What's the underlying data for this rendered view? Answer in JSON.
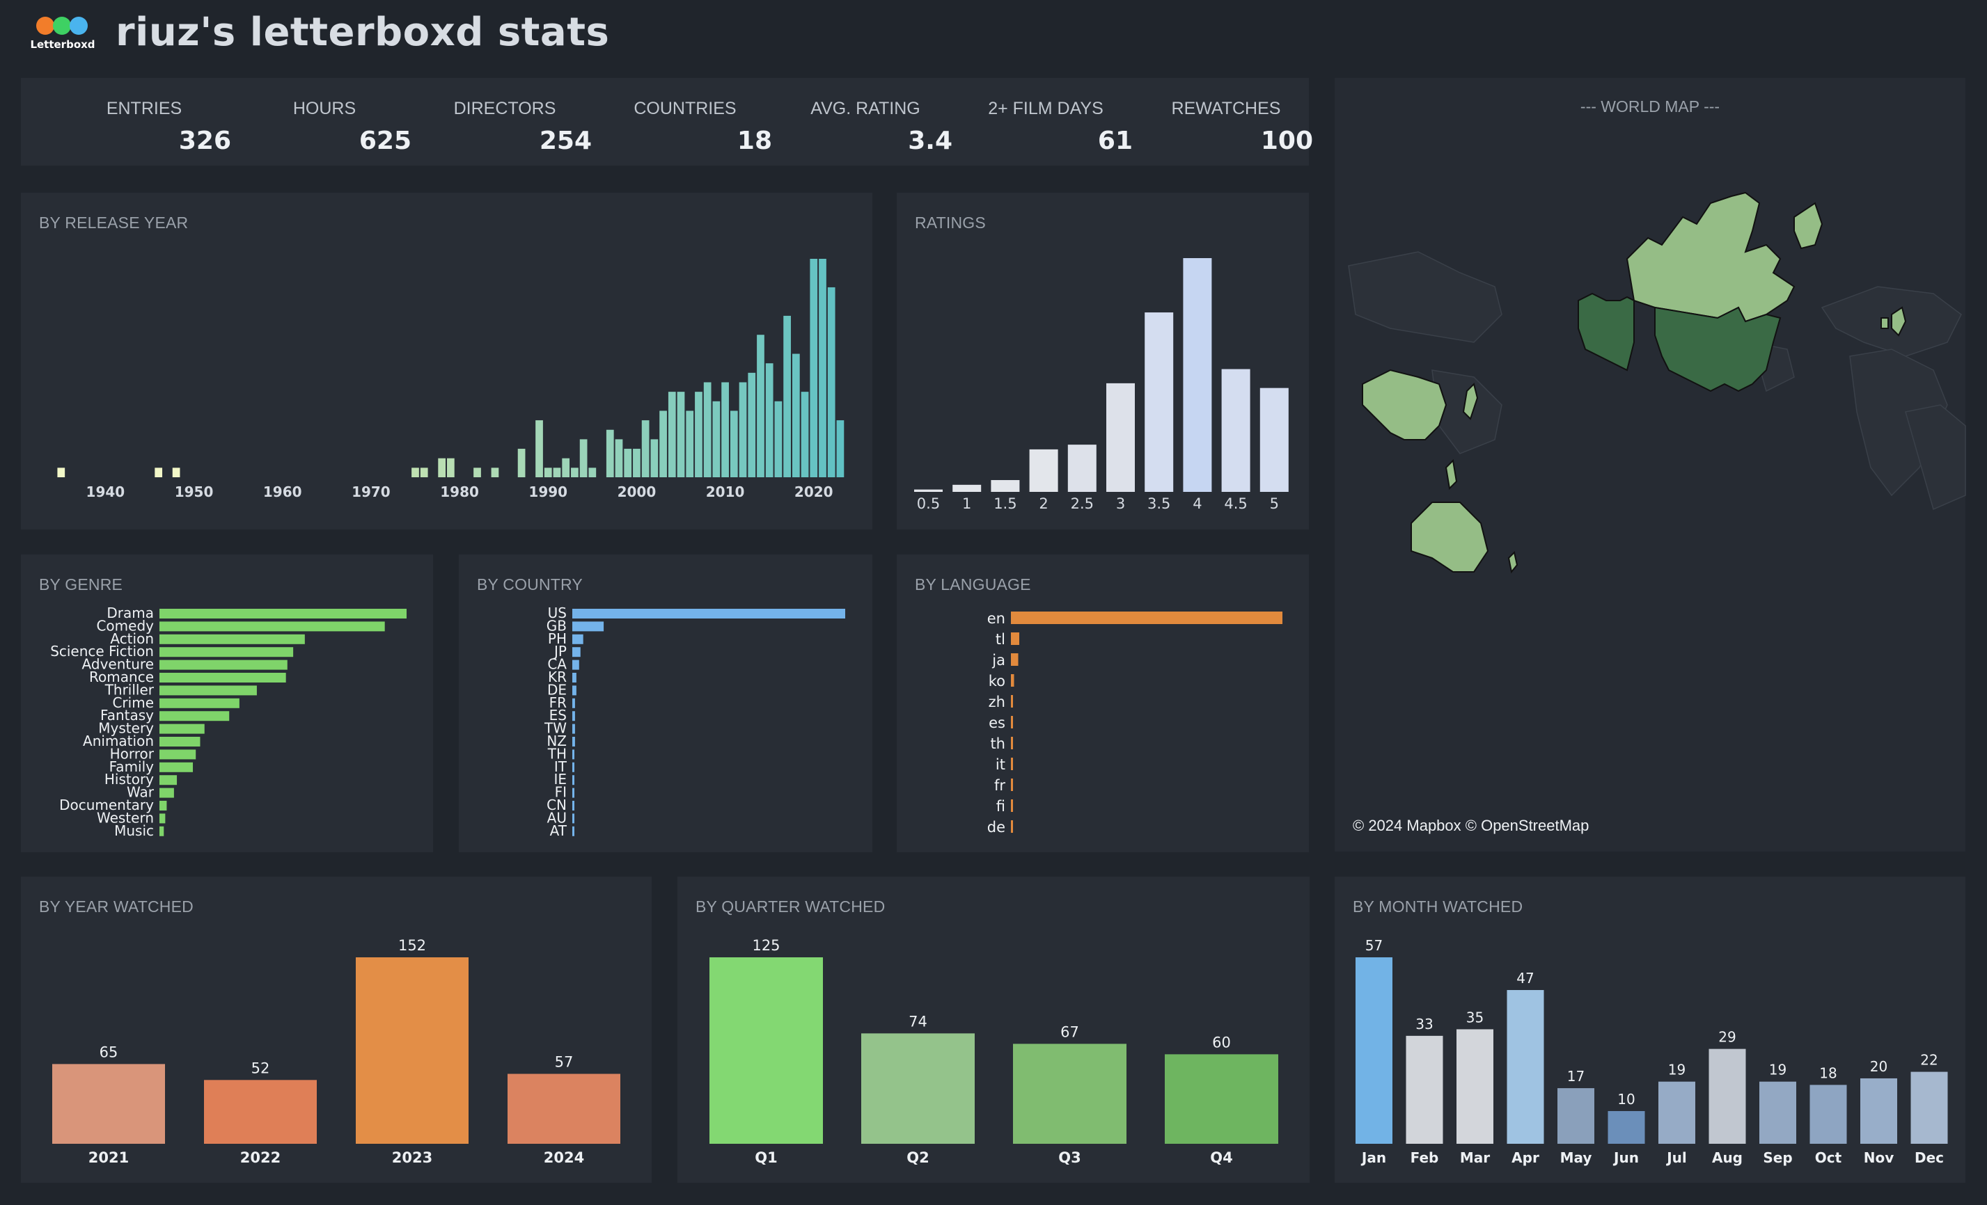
{
  "header": {
    "title": "riuz's letterboxd stats",
    "logo_text": "Letterboxd",
    "logo_colors": [
      "#ff8000",
      "#00e054",
      "#40bcf4"
    ]
  },
  "stats": [
    {
      "label": "ENTRIES",
      "value": "326"
    },
    {
      "label": "HOURS",
      "value": "625"
    },
    {
      "label": "DIRECTORS",
      "value": "254"
    },
    {
      "label": "COUNTRIES",
      "value": "18"
    },
    {
      "label": "AVG. RATING",
      "value": "3.4"
    },
    {
      "label": "2+ FILM DAYS",
      "value": "61"
    },
    {
      "label": "REWATCHES",
      "value": "100"
    }
  ],
  "panels": {
    "release_year": "BY RELEASE YEAR",
    "ratings": "RATINGS",
    "genre": "BY GENRE",
    "country": "BY COUNTRY",
    "language": "BY LANGUAGE",
    "year_watched": "BY YEAR WATCHED",
    "quarter_watched": "BY QUARTER WATCHED",
    "month_watched": "BY MONTH WATCHED",
    "world_map": "--- WORLD MAP ---",
    "map_attribution": "© 2024 Mapbox © OpenStreetMap"
  },
  "chart_data": [
    {
      "id": "release_year",
      "type": "bar",
      "title": "BY RELEASE YEAR",
      "x_ticks": [
        "1940",
        "1950",
        "1960",
        "1970",
        "1980",
        "1990",
        "2000",
        "2010",
        "2020"
      ],
      "x": [
        1935,
        1946,
        1948,
        1975,
        1976,
        1978,
        1979,
        1982,
        1984,
        1987,
        1989,
        1990,
        1991,
        1992,
        1993,
        1994,
        1995,
        1997,
        1998,
        1999,
        2000,
        2001,
        2002,
        2003,
        2004,
        2005,
        2006,
        2007,
        2008,
        2009,
        2010,
        2011,
        2012,
        2013,
        2014,
        2015,
        2016,
        2017,
        2018,
        2019,
        2020,
        2021,
        2022,
        2023
      ],
      "values": [
        1,
        1,
        1,
        1,
        1,
        2,
        2,
        1,
        1,
        3,
        6,
        1,
        1,
        2,
        1,
        4,
        1,
        5,
        4,
        3,
        3,
        6,
        4,
        7,
        9,
        9,
        7,
        9,
        10,
        8,
        10,
        7,
        10,
        11,
        15,
        12,
        8,
        17,
        13,
        9,
        23,
        23,
        20,
        6
      ]
    },
    {
      "id": "ratings",
      "type": "bar",
      "title": "RATINGS",
      "categories": [
        "0.5",
        "1",
        "1.5",
        "2",
        "2.5",
        "3",
        "3.5",
        "4",
        "4.5",
        "5"
      ],
      "values": [
        1,
        3,
        5,
        18,
        20,
        46,
        76,
        99,
        52,
        44
      ]
    },
    {
      "id": "genre",
      "type": "bar",
      "title": "BY GENRE",
      "categories": [
        "Drama",
        "Comedy",
        "Action",
        "Science Fiction",
        "Adventure",
        "Romance",
        "Thriller",
        "Crime",
        "Fantasy",
        "Mystery",
        "Animation",
        "Horror",
        "Family",
        "History",
        "War",
        "Documentary",
        "Western",
        "Music"
      ],
      "values": [
        170,
        155,
        100,
        92,
        88,
        87,
        67,
        55,
        48,
        31,
        28,
        25,
        23,
        12,
        10,
        5,
        4,
        3
      ]
    },
    {
      "id": "country",
      "type": "bar",
      "title": "BY COUNTRY",
      "categories": [
        "US",
        "GB",
        "PH",
        "JP",
        "CA",
        "KR",
        "DE",
        "FR",
        "ES",
        "TW",
        "NZ",
        "TH",
        "IT",
        "IE",
        "FI",
        "CN",
        "AU",
        "AT"
      ],
      "values": [
        200,
        23,
        8,
        6,
        5,
        3,
        3,
        2,
        2,
        2,
        2,
        1,
        1,
        1,
        1,
        1,
        1,
        1
      ]
    },
    {
      "id": "language",
      "type": "bar",
      "title": "BY LANGUAGE",
      "categories": [
        "en",
        "tl",
        "ja",
        "ko",
        "zh",
        "es",
        "th",
        "it",
        "fr",
        "fi",
        "de"
      ],
      "values": [
        260,
        8,
        7,
        3,
        2,
        1,
        1,
        1,
        1,
        1,
        1
      ]
    },
    {
      "id": "year_watched",
      "type": "bar",
      "title": "BY YEAR WATCHED",
      "categories": [
        "2021",
        "2022",
        "2023",
        "2024"
      ],
      "values": [
        65,
        52,
        152,
        57
      ],
      "colors": [
        "#d9957a",
        "#df7f57",
        "#e38e47",
        "#db8360"
      ]
    },
    {
      "id": "quarter_watched",
      "type": "bar",
      "title": "BY QUARTER WATCHED",
      "categories": [
        "Q1",
        "Q2",
        "Q3",
        "Q4"
      ],
      "values": [
        125,
        74,
        67,
        60
      ],
      "colors": [
        "#83d872",
        "#94c38b",
        "#80bc70",
        "#6eb560"
      ]
    },
    {
      "id": "month_watched",
      "type": "bar",
      "title": "BY MONTH WATCHED",
      "categories": [
        "Jan",
        "Feb",
        "Mar",
        "Apr",
        "May",
        "Jun",
        "Jul",
        "Aug",
        "Sep",
        "Oct",
        "Nov",
        "Dec"
      ],
      "values": [
        57,
        33,
        35,
        47,
        17,
        10,
        19,
        29,
        19,
        18,
        20,
        22
      ],
      "colors": [
        "#72b3e6",
        "#d2d5da",
        "#d3d6db",
        "#9fc3e2",
        "#8aa0bb",
        "#6b8fba",
        "#96abc6",
        "#c1c7d0",
        "#93a8c3",
        "#8ea5c2",
        "#98aec9",
        "#a6b8cf"
      ]
    }
  ]
}
